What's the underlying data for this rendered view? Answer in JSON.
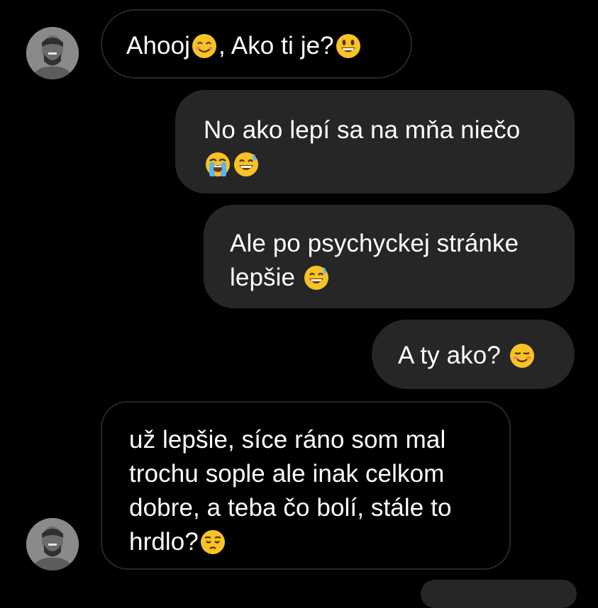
{
  "messages": [
    {
      "direction": "incoming",
      "text": "Ahooj",
      "emoji1": "smiling-face-with-smiling-eyes",
      "text2": ", Ako ti je?",
      "emoji2": "grinning-face"
    },
    {
      "direction": "outgoing",
      "line1": "No ako lepí sa na mňa niečo",
      "emoji1": "loudly-crying-face",
      "emoji2": "grinning-face-with-sweat"
    },
    {
      "direction": "outgoing",
      "line1": "Ale po psychyckej stránke",
      "line2": "lepšie",
      "emoji1": "grinning-face-with-sweat"
    },
    {
      "direction": "outgoing",
      "text": "A ty ako?",
      "emoji1": "smiling-face"
    },
    {
      "direction": "incoming",
      "line1": "už lepšie, síce ráno som mal",
      "line2": "trochu sople ale inak celkom",
      "line3": "dobre, a teba čo bolí, stále to",
      "line4": "hrdlo?",
      "emoji1": "pensive-face"
    }
  ],
  "colors": {
    "background": "#000000",
    "outgoing_bubble": "#262626",
    "incoming_border": "#262626",
    "text": "#ffffff",
    "emoji_yellow": "#f7c326"
  }
}
